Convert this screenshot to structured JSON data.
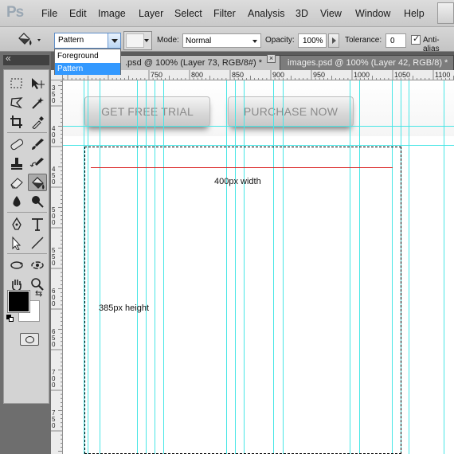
{
  "app": {
    "logo": "Ps"
  },
  "menu": [
    "File",
    "Edit",
    "Image",
    "Layer",
    "Select",
    "Filter",
    "Analysis",
    "3D",
    "View",
    "Window",
    "Help"
  ],
  "options": {
    "fill_source": "Pattern",
    "mode_label": "Mode:",
    "mode_value": "Normal",
    "opacity_label": "Opacity:",
    "opacity_value": "100%",
    "tolerance_label": "Tolerance:",
    "tolerance_value": "0",
    "antialias_label": "Anti-alias",
    "antialias_checked": true
  },
  "fill_dropdown": {
    "options": [
      "Foreground",
      "Pattern"
    ],
    "selected": "Pattern"
  },
  "tabs": [
    {
      "label": ".psd @ 100% (Layer 73, RGB/8#) *",
      "active": true
    },
    {
      "label": "images.psd @ 100% (Layer 42, RGB/8) *",
      "active": false
    }
  ],
  "ruler": {
    "top_labels": [
      "750",
      "800",
      "850",
      "900",
      "950",
      "1000",
      "1050",
      "1100"
    ],
    "left_labels": [
      "3\n5\n0",
      "4\n0\n0",
      "4\n5\n0",
      "5\n0\n0",
      "5\n5\n0",
      "6\n0\n0",
      "6\n5\n0",
      "7\n0\n0",
      "7\n5\n0"
    ]
  },
  "canvas": {
    "buttons": [
      "GET FREE TRIAL",
      "PURCHASE NOW"
    ],
    "width_annotation": "400px width",
    "height_annotation": "385px height"
  },
  "colors": {
    "foreground": "#000000",
    "background": "#ffffff",
    "guide": "#48e6e6",
    "measure_line": "#d92020",
    "selected_item": "#3399ff"
  },
  "tools": [
    "marquee-tool",
    "move-tool",
    "lasso-tool",
    "magic-wand-tool",
    "crop-tool",
    "eyedropper-tool",
    "healing-brush-tool",
    "brush-tool",
    "clone-stamp-tool",
    "history-brush-tool",
    "eraser-tool",
    "paint-bucket-tool",
    "blur-tool",
    "dodge-tool",
    "pen-tool",
    "type-tool",
    "path-selection-tool",
    "line-tool",
    "3d-rotate-tool",
    "3d-orbit-tool",
    "hand-tool",
    "zoom-tool"
  ]
}
